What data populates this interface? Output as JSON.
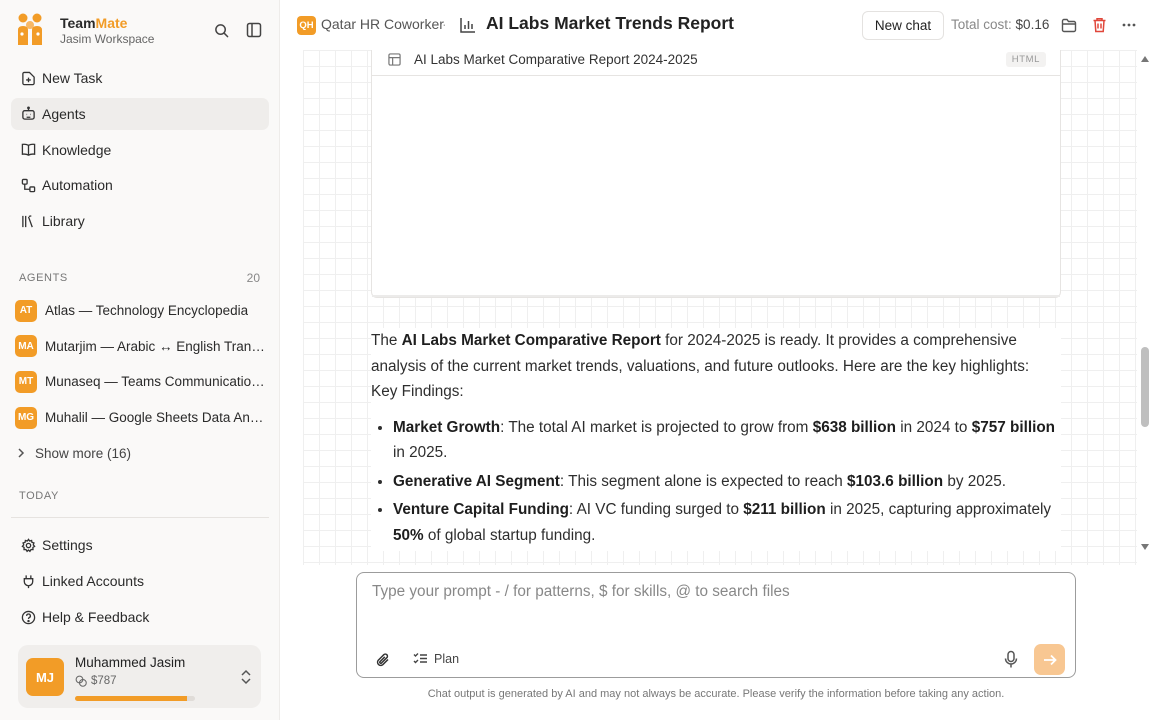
{
  "brand": {
    "name_part1": "Team",
    "name_part2": "Mate",
    "workspace": "Jasim Workspace"
  },
  "nav": {
    "items": [
      {
        "label": "New Task",
        "icon": "new-task-icon"
      },
      {
        "label": "Agents",
        "icon": "agents-icon",
        "active": true
      },
      {
        "label": "Knowledge",
        "icon": "book-icon"
      },
      {
        "label": "Automation",
        "icon": "automation-icon"
      },
      {
        "label": "Library",
        "icon": "library-icon"
      }
    ]
  },
  "agents_section": {
    "label": "AGENTS",
    "count": "20",
    "items": [
      {
        "initials": "AT",
        "label": "Atlas — Technology Encyclopedia"
      },
      {
        "initials": "MA",
        "label": "Mutarjim — Arabic ↔ English Translator"
      },
      {
        "initials": "MT",
        "label": "Munaseq — Teams Communication Assistant"
      },
      {
        "initials": "MG",
        "label": "Muhalil — Google Sheets Data Analyst"
      }
    ],
    "show_more": "Show more (16)"
  },
  "today_label": "TODAY",
  "bottom_nav": {
    "items": [
      {
        "label": "Settings",
        "icon": "gear-icon"
      },
      {
        "label": "Linked Accounts",
        "icon": "plug-icon"
      },
      {
        "label": "Help & Feedback",
        "icon": "help-icon"
      }
    ]
  },
  "profile": {
    "initials": "MJ",
    "name": "Muhammed Jasim",
    "balance": "$787",
    "usage_fraction": 0.93
  },
  "header": {
    "project_badge": "QH",
    "project_name": "Qatar HR Coworker",
    "separator": "·",
    "title": "AI Labs Market Trends Report",
    "new_chat": "New chat",
    "cost_label": "Total cost:",
    "cost_value": "$0.16"
  },
  "artifact": {
    "title": "AI Labs Market Comparative Report 2024-2025",
    "tag": "HTML"
  },
  "message": {
    "intro_pre": "The ",
    "intro_bold": "AI Labs Market Comparative Report",
    "intro_post": " for 2024-2025 is ready. It provides a comprehensive analysis of the current market trends, valuations, and future outlooks. Here are the key highlights:",
    "key_findings": "Key Findings:",
    "bullets": [
      {
        "head": "Market Growth",
        "t1": ": The total AI market is projected to grow from ",
        "b1": "$638 billion",
        "t2": " in 2024 to ",
        "b2": "$757 billion",
        "t3": " in 2025."
      },
      {
        "head": "Generative AI Segment",
        "t1": ": This segment alone is expected to reach ",
        "b1": "$103.6 billion",
        "t2": " by 2025."
      },
      {
        "head": "Venture Capital Funding",
        "t1": ": AI VC funding surged to ",
        "b1": "$211 billion",
        "t2": " in 2025, capturing approximately ",
        "b2": "50%",
        "t3": " of global startup funding."
      }
    ]
  },
  "composer": {
    "placeholder": "Type your prompt - / for patterns, $ for skills, @ to search files",
    "plan_label": "Plan"
  },
  "disclaimer": "Chat output is generated by AI and may not always be accurate. Please verify the information before taking any action.",
  "colors": {
    "accent": "#f29c27",
    "send_button": "#f8c792",
    "delete": "#e0463a"
  }
}
